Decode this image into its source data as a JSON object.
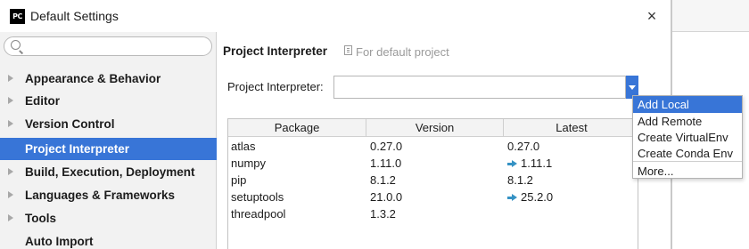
{
  "window": {
    "title": "Default Settings",
    "app_icon_text": "PC",
    "close_glyph": "×"
  },
  "sidebar": {
    "search": {
      "value": "",
      "placeholder": ""
    },
    "items": [
      {
        "label": "Appearance & Behavior",
        "expandable": true,
        "selected": false
      },
      {
        "label": "Editor",
        "expandable": true,
        "selected": false
      },
      {
        "label": "Version Control",
        "expandable": true,
        "selected": false
      },
      {
        "label": "Project Interpreter",
        "expandable": false,
        "selected": true
      },
      {
        "label": "Build, Execution, Deployment",
        "expandable": true,
        "selected": false
      },
      {
        "label": "Languages & Frameworks",
        "expandable": true,
        "selected": false
      },
      {
        "label": "Tools",
        "expandable": true,
        "selected": false
      },
      {
        "label": "Auto Import",
        "expandable": false,
        "selected": false
      }
    ]
  },
  "main": {
    "title": "Project Interpreter",
    "subtitle": "For default project",
    "interpreter_label": "Project Interpreter:",
    "interpreter_value": "",
    "table": {
      "columns": [
        "Package",
        "Version",
        "Latest"
      ],
      "rows": [
        {
          "package": "atlas",
          "version": "0.27.0",
          "latest": "0.27.0",
          "upgrade": false
        },
        {
          "package": "numpy",
          "version": "1.11.0",
          "latest": "1.11.1",
          "upgrade": true
        },
        {
          "package": "pip",
          "version": "8.1.2",
          "latest": "8.1.2",
          "upgrade": false
        },
        {
          "package": "setuptools",
          "version": "21.0.0",
          "latest": "25.2.0",
          "upgrade": true
        },
        {
          "package": "threadpool",
          "version": "1.3.2",
          "latest": "",
          "upgrade": false
        }
      ]
    }
  },
  "popup": {
    "items": [
      {
        "label": "Add Local",
        "selected": true
      },
      {
        "label": "Add Remote",
        "selected": false
      },
      {
        "label": "Create VirtualEnv",
        "selected": false
      },
      {
        "label": "Create Conda Env",
        "selected": false
      },
      {
        "label": "More...",
        "selected": false
      }
    ]
  },
  "colors": {
    "selection": "#3875d7",
    "upgrade_arrow": "#3592c4",
    "sidebar_bg": "#f2f2f2",
    "muted_text": "#9a9a9a"
  },
  "icons": {
    "app": "pycharm-logo-icon",
    "search": "search-icon",
    "close": "close-icon",
    "upgrade": "upgrade-arrow-icon",
    "dropdown": "chevron-down-icon"
  }
}
